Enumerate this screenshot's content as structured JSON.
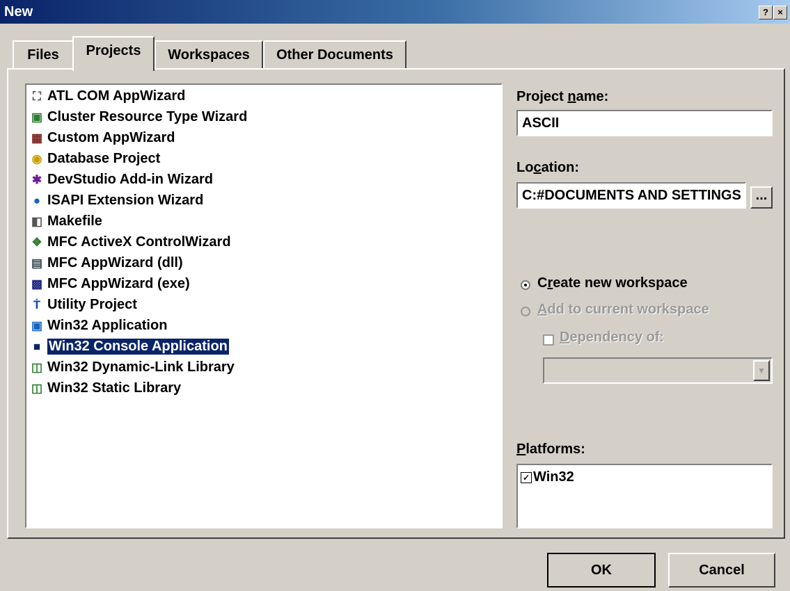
{
  "window": {
    "title": "New",
    "help_glyph": "?",
    "close_glyph": "×"
  },
  "tabs": [
    {
      "label": "Files"
    },
    {
      "label": "Projects"
    },
    {
      "label": "Workspaces"
    },
    {
      "label": "Other Documents"
    }
  ],
  "active_tab": "Projects",
  "project_types": [
    {
      "label": "ATL COM AppWizard",
      "icon": "atl-icon"
    },
    {
      "label": "Cluster Resource Type Wizard",
      "icon": "cluster-icon"
    },
    {
      "label": "Custom AppWizard",
      "icon": "custom-wizard-icon"
    },
    {
      "label": "Database Project",
      "icon": "database-icon"
    },
    {
      "label": "DevStudio Add-in Wizard",
      "icon": "addin-icon"
    },
    {
      "label": "ISAPI Extension Wizard",
      "icon": "globe-icon"
    },
    {
      "label": "Makefile",
      "icon": "makefile-icon"
    },
    {
      "label": "MFC ActiveX ControlWizard",
      "icon": "activex-icon"
    },
    {
      "label": "MFC AppWizard (dll)",
      "icon": "mfc-dll-icon"
    },
    {
      "label": "MFC AppWizard (exe)",
      "icon": "mfc-exe-icon"
    },
    {
      "label": "Utility Project",
      "icon": "utility-icon"
    },
    {
      "label": "Win32 Application",
      "icon": "win32-app-icon"
    },
    {
      "label": "Win32 Console Application",
      "icon": "console-icon",
      "selected": true
    },
    {
      "label": "Win32 Dynamic-Link Library",
      "icon": "dll-icon"
    },
    {
      "label": "Win32 Static Library",
      "icon": "lib-icon"
    }
  ],
  "project_name": {
    "label_pre": "Project ",
    "label_ul": "n",
    "label_post": "ame:",
    "value": "ASCII"
  },
  "location": {
    "label_pre": "Lo",
    "label_ul": "c",
    "label_post": "ation:",
    "value": "C:#DOCUMENTS AND SETTINGS",
    "browse_label": "..."
  },
  "workspace": {
    "create_pre": "C",
    "create_ul": "r",
    "create_post": "eate new workspace",
    "add_ul": "A",
    "add_post": "dd to current workspace",
    "dependency_ul": "D",
    "dependency_post": "ependency of:",
    "create_selected": true
  },
  "platforms": {
    "label_ul": "P",
    "label_post": "latforms:",
    "items": [
      {
        "label": "Win32",
        "checked": true
      }
    ]
  },
  "buttons": {
    "ok": "OK",
    "cancel": "Cancel"
  }
}
